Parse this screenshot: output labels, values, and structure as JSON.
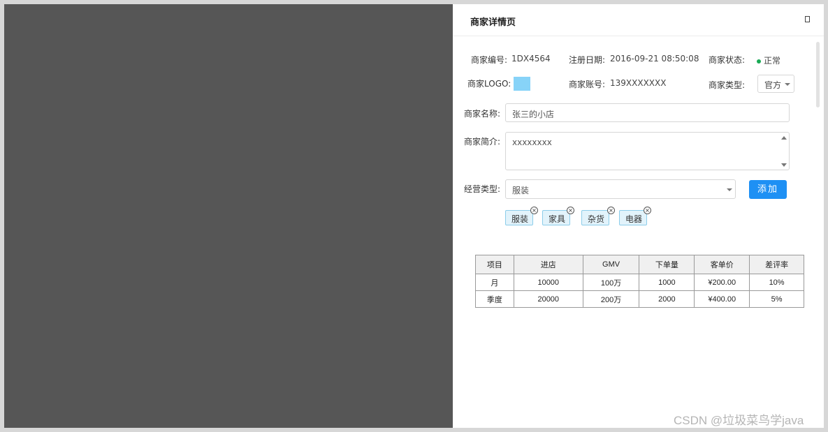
{
  "panel": {
    "title": "商家详情页"
  },
  "info": {
    "merchant_no_label": "商家编号:",
    "merchant_no": "1DX4564",
    "reg_date_label": "注册日期:",
    "reg_date": "2016-09-21  08:50:08",
    "status_label": "商家状态:",
    "status": "正常",
    "status_color": "#1aaa55",
    "logo_label": "商家LOGO:",
    "logo_color": "#87d3f8",
    "account_label": "商家账号:",
    "account": "139XXXXXXX",
    "type_label": "商家类型:",
    "type_value": "官方"
  },
  "form": {
    "name_label": "商家名称:",
    "name_value": "张三的小店",
    "intro_label": "商家简介:",
    "intro_value": "xxxxxxxx",
    "biz_type_label": "经营类型:",
    "biz_type_value": "服装",
    "add_button": "添加",
    "tags": [
      "服装",
      "家具",
      "杂货",
      "电器"
    ]
  },
  "table": {
    "headers": [
      "项目",
      "进店",
      "GMV",
      "下单量",
      "客单价",
      "差评率"
    ],
    "rows": [
      [
        "月",
        "10000",
        "100万",
        "1000",
        "¥200.00",
        "10%"
      ],
      [
        "季度",
        "20000",
        "200万",
        "2000",
        "¥400.00",
        "5%"
      ]
    ]
  },
  "watermark": "CSDN @垃圾菜鸟学java",
  "colors": {
    "accent": "#1e90f4",
    "overlay": "#565656",
    "tag_border": "#8ccdea",
    "tag_bg": "#e2f3fb"
  }
}
